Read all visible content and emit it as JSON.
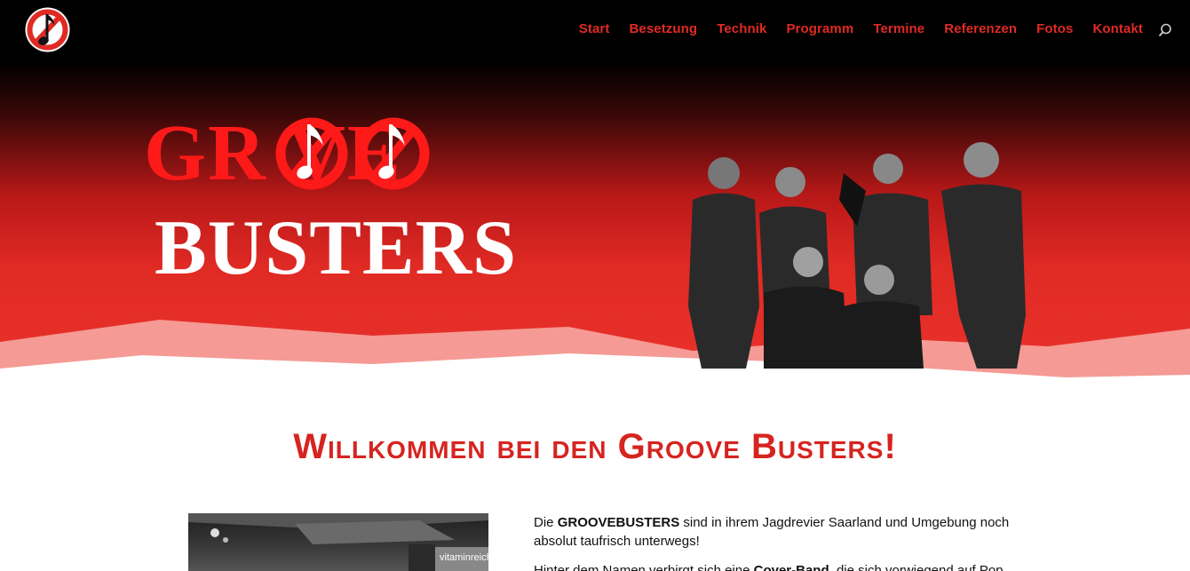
{
  "nav": {
    "items": [
      "Start",
      "Besetzung",
      "Technik",
      "Programm",
      "Termine",
      "Referenzen",
      "Fotos",
      "Kontakt"
    ],
    "logo_icon": "no-music-note-logo",
    "search_icon": "search-icon"
  },
  "hero": {
    "title_line1": "GR    VE",
    "title_line2": "BUSTERS"
  },
  "welcome": {
    "heading": "Willkommen bei den Groove Busters!"
  },
  "intro": {
    "p1_pre": "Die ",
    "p1_bold": "GROOVEBUSTERS",
    "p1_post": " sind in ihrem Jagdrevier Saarland und Umgebung noch absolut taufrisch unterwegs!",
    "p2_pre": "Hinter dem Namen verbirgt sich eine ",
    "p2_bold": "Cover-Band",
    "p2_post": ", die sich vorwiegend auf Pop"
  },
  "stage_photo": {
    "sign_text": "vitaminreich"
  },
  "colors": {
    "accent": "#e02a24",
    "heading": "#d62420",
    "groove": "#ff1a1a"
  }
}
